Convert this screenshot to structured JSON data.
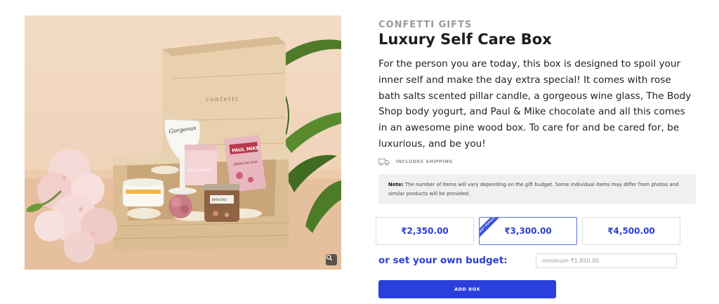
{
  "product": {
    "brand": "CONFETTI GIFTS",
    "title": "Luxury Self Care Box",
    "description": "For the person you are today, this box is designed to spoil your inner self and make the day extra special! It comes with rose bath salts scented pillar candle, a gorgeous wine glass, The Body Shop body yogurt, and Paul & Mike chocolate and all this comes in an awesome pine wood box. To care for and be cared for, be luxurious, and be you!"
  },
  "image": {
    "box_brand": "confetti",
    "glass_text": "Gorgeous",
    "candle_text": "SWEET & SPICY",
    "chocolate_brand": "PAUL MIKE",
    "chocolate_flavour": "JAMAICAN RUM",
    "salts_text": "BATH SALT"
  },
  "shipping": {
    "label": "INCLUDES SHIPPING",
    "icon": "truck-icon"
  },
  "note": {
    "label": "Note:",
    "text": " The number of items will vary depending on the gift budget. Some individual items may differ from photos and similar products will be provided."
  },
  "budget_options": [
    {
      "label": "₹2,350.00",
      "selected": false
    },
    {
      "label": "₹3,300.00",
      "selected": true,
      "badge": "MOST POPULAR"
    },
    {
      "label": "₹4,500.00",
      "selected": false
    }
  ],
  "own_budget": {
    "label": "or set your own budget:",
    "placeholder": "minimum ₹1,850.00",
    "value": ""
  },
  "add_button": {
    "label": "ADD BOX"
  },
  "colors": {
    "accent": "#2b40d2",
    "button": "#2b3fdc",
    "note_bg": "#f0f0f0",
    "brand_gray": "#9a9a9a"
  }
}
